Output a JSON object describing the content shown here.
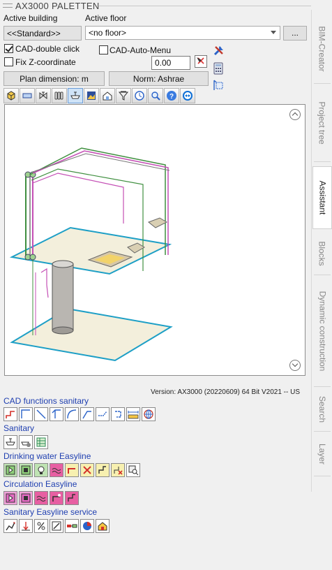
{
  "window": {
    "title": "AX3000 PALETTEN"
  },
  "building": {
    "label": "Active building",
    "value": "<<Standard>>"
  },
  "floor": {
    "label": "Active floor",
    "value": "<no floor>",
    "more_label": "..."
  },
  "options": {
    "cad_double_click": {
      "label": "CAD-double click",
      "checked": true
    },
    "cad_auto_menu": {
      "label": "CAD-Auto-Menu",
      "checked": false
    },
    "fix_z": {
      "label": "Fix Z-coordinate",
      "checked": false
    },
    "z_value": "0.00"
  },
  "buttons": {
    "plan_dimension": "Plan dimension: m",
    "norm": "Norm: Ashrae"
  },
  "toolbar_icons": [
    "cube-icon",
    "beam-icon",
    "valve-icon",
    "radiator-icon",
    "sink-icon",
    "image-icon",
    "house-icon",
    "funnel-icon",
    "clock-icon",
    "zoom-icon",
    "help-icon",
    "teamviewer-icon"
  ],
  "version": "Version: AX3000 (20220609) 64 Bit V2021  -- US",
  "sections": {
    "cad_functions": {
      "title": "CAD functions sanitary",
      "icons": [
        "step-line-icon",
        "line-icon",
        "diagonal-line-icon",
        "offset-line-icon",
        "arc-line-icon",
        "corner-line-icon",
        "dashed-line-icon",
        "bracket-line-icon",
        "measure-icon",
        "globe-icon"
      ]
    },
    "sanitary": {
      "title": "Sanitary",
      "icons": [
        "washbasin-icon",
        "washbasin-gear-icon",
        "table-grid-icon"
      ]
    },
    "drinking_water": {
      "title": "Drinking water Easyline",
      "icons": [
        "dw-play-icon",
        "dw-box-icon",
        "dw-bulb-icon",
        "dw-wave-icon",
        "dw-pipe-icon",
        "dw-cross-icon",
        "dw-corner-icon",
        "dw-corner-x-icon",
        "dw-search-icon"
      ]
    },
    "circulation": {
      "title": "Circulation Easyline",
      "icons": [
        "circ-play-icon",
        "circ-box-icon",
        "circ-wave-icon",
        "circ-pipe-icon",
        "circ-corner-icon"
      ]
    },
    "sanitary_service": {
      "title": "Sanitary Easyline service",
      "icons": [
        "svc-chart-icon",
        "svc-down-icon",
        "svc-percent-icon",
        "svc-slash-icon",
        "svc-connector-icon",
        "svc-pie-icon",
        "svc-house-icon"
      ]
    }
  },
  "side_tabs": [
    "BIM-Creator",
    "Project tree",
    "Assistant",
    "Blocks",
    "Dynamic construction",
    "Search",
    "Layer"
  ],
  "active_tab": "Assistant"
}
